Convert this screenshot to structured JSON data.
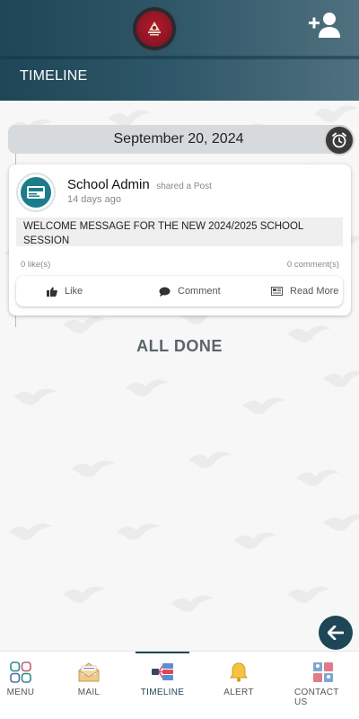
{
  "header": {
    "title": "TIMELINE",
    "logo_icon": "school-crest-icon",
    "add_user_icon": "add-user-icon",
    "gradient_start": "#1f4656",
    "gradient_end": "#50707e"
  },
  "timeline": {
    "date": "September 20, 2024",
    "alarm_icon": "alarm-clock-icon",
    "posts": [
      {
        "author": "School Admin",
        "action_text": "shared a Post",
        "time": "14 days ago",
        "body": "WELCOME MESSAGE FOR THE NEW 2024/2025 SCHOOL SESSION",
        "likes": "0 like(s)",
        "comments": "0 comment(s)",
        "actions": {
          "like": "Like",
          "comment": "Comment",
          "read_more": "Read More"
        }
      }
    ],
    "end_text": "ALL DONE"
  },
  "fab": {
    "icon": "back-arrow-icon"
  },
  "bottom_nav": {
    "items": [
      {
        "label": "MENU",
        "icon": "grid-icon"
      },
      {
        "label": "MAIL",
        "icon": "mail-icon"
      },
      {
        "label": "TIMELINE",
        "icon": "timeline-icon"
      },
      {
        "label": "ALERT",
        "icon": "bell-icon"
      },
      {
        "label": "CONTACT US",
        "icon": "contact-icon"
      }
    ],
    "active": "TIMELINE",
    "accent": "#1f4656"
  }
}
